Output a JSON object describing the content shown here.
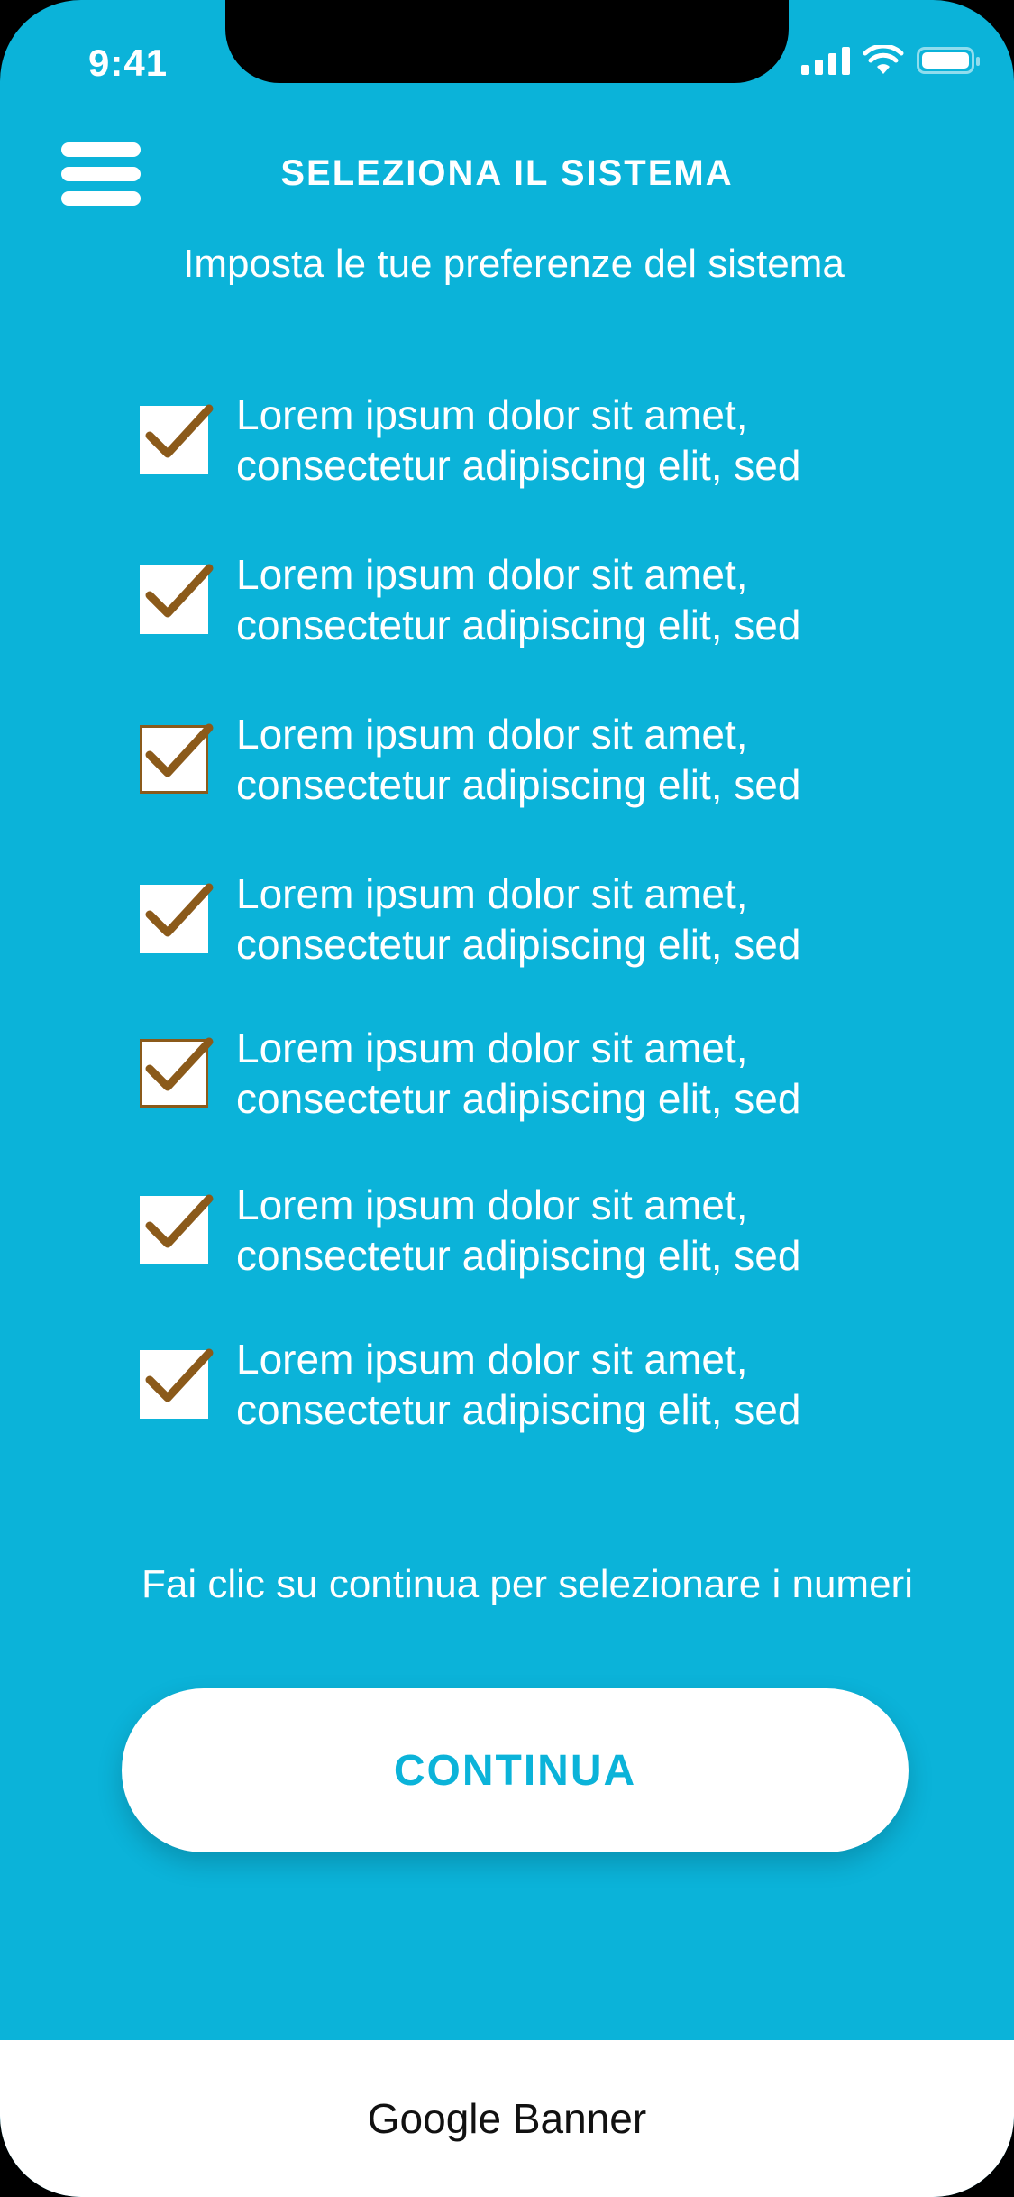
{
  "status_bar": {
    "time": "9:41"
  },
  "header": {
    "title": "SELEZIONA IL SISTEMA",
    "subtitle": "Imposta le tue preferenze del sistema"
  },
  "options": [
    {
      "line1": "Lorem ipsum dolor sit amet,",
      "line2": "consectetur adipiscing elit, sed",
      "checked": true
    },
    {
      "line1": "Lorem ipsum dolor sit amet,",
      "line2": "consectetur adipiscing elit, sed",
      "checked": true
    },
    {
      "line1": "Lorem ipsum dolor sit amet,",
      "line2": "consectetur adipiscing elit, sed",
      "checked": true
    },
    {
      "line1": "Lorem ipsum dolor sit amet,",
      "line2": "consectetur adipiscing elit, sed",
      "checked": true
    },
    {
      "line1": "Lorem ipsum dolor sit amet,",
      "line2": "consectetur adipiscing elit, sed",
      "checked": true
    },
    {
      "line1": "Lorem ipsum dolor sit amet,",
      "line2": "consectetur adipiscing elit, sed",
      "checked": true
    },
    {
      "line1": "Lorem ipsum dolor sit amet,",
      "line2": "consectetur adipiscing elit, sed",
      "checked": true
    }
  ],
  "hint": "Fai clic su continua per selezionare i numeri",
  "continue_label": "CONTINUA",
  "banner": "Google Banner",
  "colors": {
    "background": "#0bb3d9",
    "checkmark": "#8b5a1a",
    "button_text": "#0bb3d9"
  },
  "icons": [
    "menu-icon",
    "signal-icon",
    "wifi-icon",
    "battery-icon",
    "checkmark-icon"
  ]
}
